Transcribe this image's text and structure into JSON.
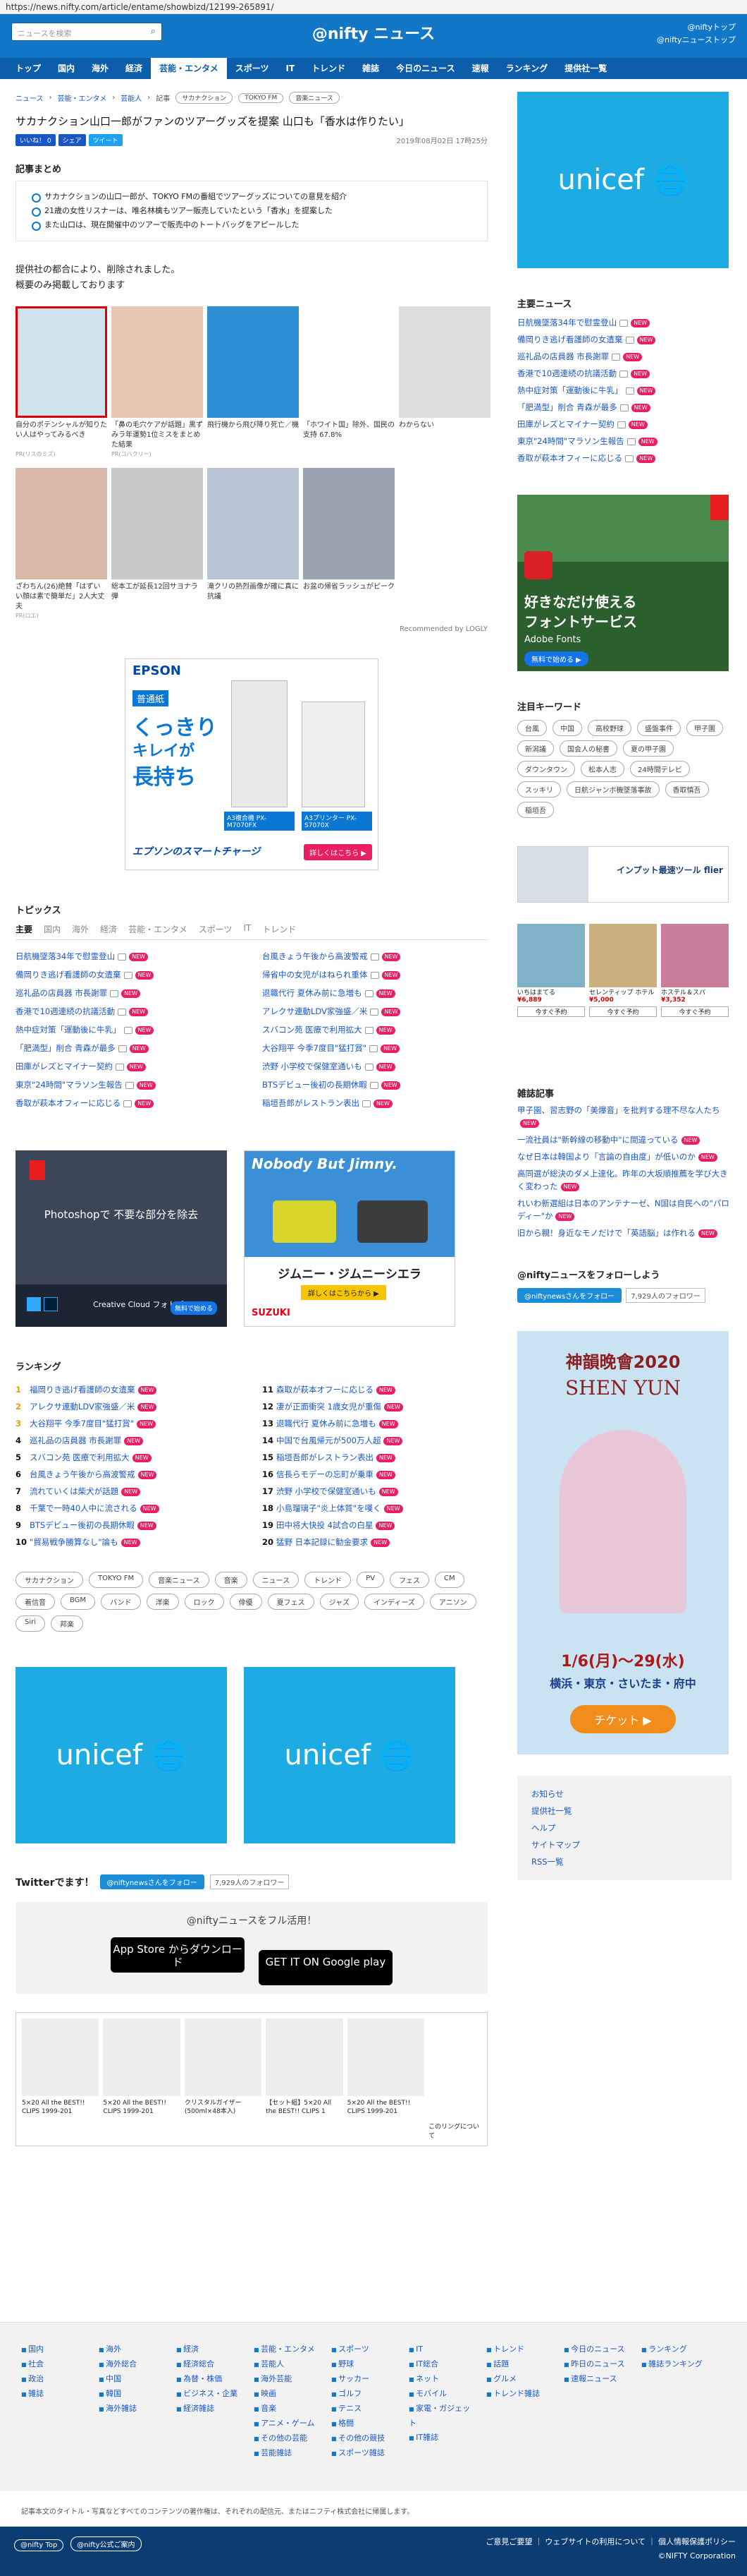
{
  "browser": {
    "url": "https://news.nifty.com/article/entame/showbizd/12199-265891/"
  },
  "header": {
    "search_placeholder": "ニュースを検索",
    "logo": "@nifty ニュース",
    "links": [
      "@niftyトップ",
      "@niftyニューストップ"
    ]
  },
  "nav": [
    "トップ",
    "国内",
    "海外",
    "経済",
    "芸能・エンタメ",
    "スポーツ",
    "IT",
    "トレンド",
    "雑誌",
    "今日のニュース",
    "速報",
    "ランキング",
    "提供社一覧"
  ],
  "breadcrumb": [
    "ニュース",
    "芸能・エンタメ",
    "芸能人",
    "記事"
  ],
  "article_tags": [
    "サカナクション",
    "TOKYO FM",
    "音楽ニュース"
  ],
  "article": {
    "title": "サカナクション山口一郎がファンのツアーグッズを提案 山口も「香水は作りたい」",
    "share_buttons": [
      "いいね！ 0",
      "シェア",
      "ツイート"
    ],
    "date": "2019年08月02日 17時25分",
    "summary_title": "記事まとめ",
    "summary": [
      "サカナクションの山口一郎が、TOKYO FMの番組でツアーグッズについての意見を紹介",
      "21歳の女性リスナーは、唯名林檎もツアー販売していたという「香水」を提案した",
      "また山口は、現在開催中のツアーで販売中のトートバッグをアピールした"
    ],
    "notice": [
      "提供社の都合により、削除されました。",
      "概要のみ掲載しております"
    ]
  },
  "recommend": [
    {
      "caption": "自分のポテンシャルが知りたい人はやってみるべき",
      "source": "PR(リスのミズ)",
      "color": "#cfe3ef"
    },
    {
      "caption": "「鼻の毛穴ケアが話題」黒ずみラ年運勢1位ミスをまとめた結果",
      "source": "PR(コハクリー)",
      "color": "#e8c8b5"
    },
    {
      "caption": "飛行機から飛び降り死亡／機",
      "source": "",
      "color": "#2f8fd6"
    },
    {
      "caption": "「ホワイト国」除外、国民の支持 67.8%",
      "source": "",
      "color": "#ffffff"
    },
    {
      "caption": "わからない",
      "source": "",
      "color": "#dddddd"
    },
    {
      "caption": "ざわちん(26)絶賛「はずいい顔は素で簡単だ」2人大丈夫",
      "source": "PR(ロエ)",
      "color": "#d9b8aa"
    },
    {
      "caption": "総本工が延長12回サヨナラ弾",
      "source": "",
      "color": "#c8c8c8"
    },
    {
      "caption": "滝クリの熱烈画像が確に真に抗議",
      "source": "",
      "color": "#b8c4d6"
    },
    {
      "caption": "お盆の帰省ラッシュがピーク",
      "source": "",
      "color": "#9aa3b2"
    }
  ],
  "recommended_by": "Recommended by LOGLY",
  "epson_ad": {
    "brand": "EPSON",
    "lines": [
      "普通紙",
      "くっきり",
      "キレイが",
      "長持ち"
    ],
    "left_label": "A3複合機 PX-M7070FX",
    "right_label": "A3プリンター PX-S7070X",
    "slogan": "エプソンのスマートチャージ",
    "cta": "詳しくはこちら ▶"
  },
  "topics": {
    "title": "トピックス",
    "tabs": [
      "主要",
      "国内",
      "海外",
      "経済",
      "芸能・エンタメ",
      "スポーツ",
      "IT",
      "トレンド"
    ],
    "left": [
      "日航機墜落34年で慰霊登山",
      "備岡りき逃げ看護師の女遺棄",
      "巡礼品の店員器 市長謝罪",
      "香港で10週連続の抗議活動",
      "熱中症対策「運動後に牛乳」",
      "「肥満型」削合 青森が最多",
      "田庫がレズとマイナー契約",
      "東京\"24時間\"マラソン生報告",
      "香取が萩本オフィーに応じる"
    ],
    "right": [
      "台風きょう午後から高波警戒",
      "帰省中の女児がはねられ重体",
      "退職代行 夏休み前に急増も",
      "アレクサ連動LDV家強盛／米",
      "スバコン苑 医療で利用拡大",
      "大谷翔平 今季7度目\"猛打賞\"",
      "渋野 小学校で保健室通いも",
      "BTSデビュー後初の長期休暇",
      "稲垣吾郎がレストラン表出"
    ]
  },
  "adobe_ad": {
    "headline": "Photoshopで 不要な部分を除去",
    "product": "Creative Cloud フォトプラン",
    "cta": "無料で始める"
  },
  "suzuki_ad": {
    "headline": "Nobody But Jimny.",
    "product": "ジムニー・ジムニーシエラ",
    "sub": "詳しくはこちらから ▶",
    "brand": "SUZUKI"
  },
  "ranking": {
    "title": "ランキング",
    "left": [
      "福岡りき逃げ看護師の女遺棄",
      "アレクサ連動LDV家強盛／米",
      "大谷翔平 今季7度目\"猛打賞\"",
      "巡礼品の店員器 市長謝罪",
      "スバコン苑 医療で利用拡大",
      "台風きょう午後から高波警戒",
      "流れていくは柴犬が話題",
      "千葉で一時40人中に流される",
      "BTSデビュー後初の長期休暇",
      "\"貿易戦争勝算なし\"論も"
    ],
    "right": [
      "森取が萩本オフーに応じる",
      "凄が正面衝突 1歳女児が重傷",
      "退職代行 夏休み前に急増も",
      "中国で台風帰元が500万人超",
      "稲垣吾郎がレストラン表出",
      "信長らモデーの忘町が乗車",
      "渋野 小学校で保健室通いも",
      "小島瑠璃子\"炎上体質\"を嘆く",
      "田中将大快投 4試合の白星",
      "猛野 日本記録に勧金要求"
    ]
  },
  "keywords": [
    "サカナクション",
    "TOKYO FM",
    "音楽ニュース",
    "音楽",
    "ニュース",
    "トレンド",
    "PV",
    "フェス",
    "CM",
    "着信音",
    "BGM",
    "バンド",
    "洋楽",
    "ロック",
    "俳優",
    "夏フェス",
    "ジャズ",
    "インディーズ",
    "アニソン",
    "Siri",
    "邦楽"
  ],
  "unicef_text": "unicef",
  "twitter": {
    "title": "Twitterでます！",
    "follow": "@niftynewsさんをフォロー",
    "count": "7,929人のフォロワー"
  },
  "app": {
    "title": "@niftyニュースをフル活用！",
    "appstore": "App Store からダウンロード",
    "googleplay": "GET IT ON Google play"
  },
  "rakuten": [
    {
      "caption": "5×20 All the BEST!! CLIPS 1999-201",
      "price": ""
    },
    {
      "caption": "5×20 All the BEST!! CLIPS 1999-201",
      "price": ""
    },
    {
      "caption": "クリスタルガイザー(500ml×48本入)",
      "price": ""
    },
    {
      "caption": "【セット組】5×20 All the BEST!! CLIPS 1",
      "price": ""
    },
    {
      "caption": "5×20 All the BEST!! CLIPS 1999-201",
      "price": ""
    }
  ],
  "rakuten_more": "このリングについて",
  "side": {
    "main_news_title": "主要ニュース",
    "main_news": [
      "日航機墜落34年で慰霊登山",
      "備岡りき逃げ看護師の女遺棄",
      "巡礼品の店員器 市長謝罪",
      "香港で10週連続の抗議活動",
      "熱中症対策「運動後に牛乳」",
      "「肥満型」削合 青森が最多",
      "田庫がレズとマイナー契約",
      "東京\"24時間\"マラソン生報告",
      "香取が萩本オフィーに応じる"
    ],
    "adobe_fonts": {
      "line1": "好きなだけ使える",
      "line2": "フォントサービス",
      "brand": "Adobe Fonts",
      "cta": "無料で始める ▶"
    },
    "keyword_title": "注目キーワード",
    "keywords": [
      "台風",
      "中国",
      "高校野球",
      "盛盤事件",
      "甲子園",
      "新潟議",
      "国会人の秘書",
      "夏の甲子園",
      "ダウンタウン",
      "松本人志",
      "24時間テレビ",
      "スッキリ",
      "日航ジャンボ機墜落事故",
      "香取慎吾",
      "稲垣吾"
    ],
    "flier": "インプット最速ツール flier",
    "hotels": [
      {
        "name": "いちはまてる",
        "price": "¥6,889",
        "cta": "今すぐ予約"
      },
      {
        "name": "セレンティップ ホテル",
        "price": "¥5,000",
        "cta": "今すぐ予約"
      },
      {
        "name": "ホステル＆スパ",
        "price": "¥3,352",
        "cta": "今すぐ予約"
      }
    ],
    "magazine_title": "雑誌記事",
    "magazine": [
      "甲子園、習志野の「美爆音」を批判する理不尽な人たち",
      "一流社員は\"新幹線の移動中\"に間違っている",
      "なぜ日本は韓国より「言論の自由度」が低いのか",
      "高同選が総決のダメ上達化。昨年の大坂順推薦を学び大きく変わった",
      "れいわ新選組は日本のアンテナーゼ、N国は自民への\"パロディー\"か",
      "旧から親！身近なモノだけで「英語脳」は作れる"
    ],
    "follow_title": "@niftyニュースをフォローしよう",
    "follow_btn": "@niftynewsさんをフォロー",
    "follow_count": "7,929人のフォロワー",
    "shenyun": {
      "line1": "神韻晚會2020",
      "line2": "SHEN YUN",
      "dates": "1/6(月)〜29(水)",
      "place": "横浜・東京・さいたま・府中",
      "cta": "チケット ▶"
    },
    "links": [
      "お知らせ",
      "提供社一覧",
      "ヘルプ",
      "サイトマップ",
      "RSS一覧"
    ]
  },
  "footer": {
    "cols": [
      [
        "国内",
        "社会",
        "政治",
        "雑誌"
      ],
      [
        "海外",
        "海外総合",
        "中国",
        "韓国",
        "海外雑誌"
      ],
      [
        "経済",
        "経済総合",
        "為替・株価",
        "ビジネス・企業",
        "経済雑誌"
      ],
      [
        "芸能・エンタメ",
        "芸能人",
        "海外芸能",
        "映画",
        "音楽",
        "アニメ・ゲーム",
        "その他の芸能",
        "芸能雑誌"
      ],
      [
        "スポーツ",
        "野球",
        "サッカー",
        "ゴルフ",
        "テニス",
        "格闘",
        "その他の競技",
        "スポーツ雑誌"
      ],
      [
        "IT",
        "IT総合",
        "ネット",
        "モバイル",
        "家電・ガジェット",
        "IT雑誌"
      ],
      [
        "トレンド",
        "話題",
        "グルメ",
        "トレンド雑誌"
      ],
      [
        "今日のニュース",
        "昨日のニュース",
        "速報ニュース"
      ],
      [
        "ランキング",
        "雑誌ランキング"
      ]
    ],
    "copyright_note": "記事本文のタイトル・写真などすべてのコンテンツの著作権は、それぞれの配信元、またはニフティ株式会社に帰属します。",
    "bottom_links": "ご意見ご要望 ｜ ウェブサイトの利用について ｜ 個人情報保護ポリシー",
    "company": "©NIFTY Corporation",
    "chips": [
      "@nifty Top",
      "@nifty公式ご案内"
    ]
  }
}
